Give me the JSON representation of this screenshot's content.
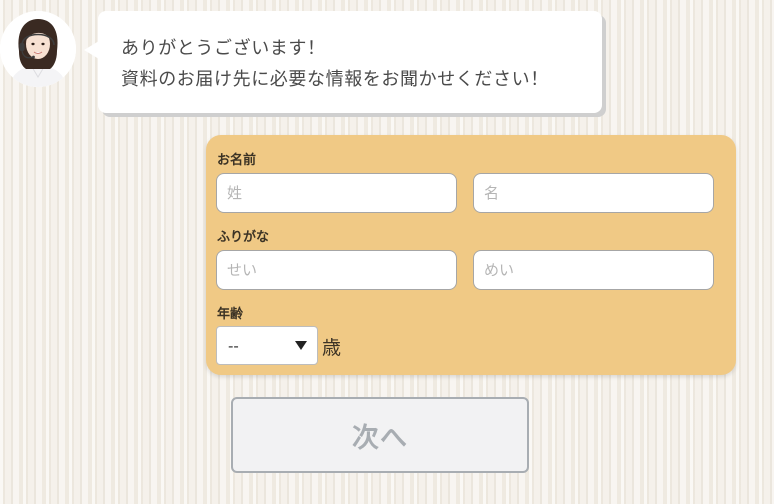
{
  "chat": {
    "bubble_lines": [
      "ありがとうございます！",
      "資料のお届け先に必要な情報をお聞かせください！"
    ]
  },
  "form": {
    "name": {
      "label": "お名前",
      "last_placeholder": "姓",
      "first_placeholder": "名",
      "last_value": "",
      "first_value": ""
    },
    "furigana": {
      "label": "ふりがな",
      "last_placeholder": "せい",
      "first_placeholder": "めい",
      "last_value": "",
      "first_value": ""
    },
    "age": {
      "label": "年齢",
      "selected": "--",
      "unit": "歳"
    }
  },
  "next_button": {
    "label": "次へ"
  },
  "colors": {
    "card_background": "#f0c985",
    "input_border": "#a6a6a6",
    "button_text": "#a8adb2",
    "button_background": "#f2f2f3"
  },
  "icons": {
    "avatar": "operator-avatar-icon",
    "select_arrow": "caret-down-icon"
  }
}
